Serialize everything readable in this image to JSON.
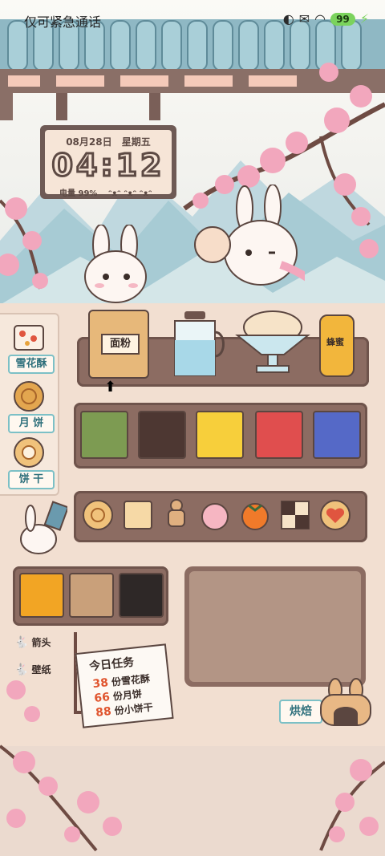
{
  "status_bar": {
    "carrier_text": "仅可紧急通话",
    "icons": [
      "notification-icon",
      "message-icon",
      "wifi-icon"
    ],
    "battery": "99"
  },
  "clock": {
    "date": "08月28日",
    "weekday": "星期五",
    "time": "04:12",
    "battery_label": "电量",
    "battery_value": "99%"
  },
  "counter_items": {
    "flour": "面粉",
    "honey": "蜂蜜"
  },
  "menu": {
    "items": [
      {
        "label": "雪花酥",
        "icon": "nougat-icon"
      },
      {
        "label": "月 饼",
        "icon": "mooncake-icon"
      },
      {
        "label": "饼 干",
        "icon": "cookie-icon"
      }
    ]
  },
  "toppings": [
    "matcha",
    "chocolate",
    "lemon",
    "strawberry",
    "blueberry"
  ],
  "cookies": [
    "swirl-cookie",
    "square-cookie",
    "gingerbread-man",
    "peach-bun",
    "persimmon",
    "checker-cookie",
    "heart-cookie"
  ],
  "mixins": [
    "mango",
    "nut-mix",
    "black-sesame"
  ],
  "options": [
    {
      "label": "箭头"
    },
    {
      "label": "壁纸"
    }
  ],
  "task": {
    "title": "今日任务",
    "lines": [
      {
        "count": "38",
        "text": "份雪花酥"
      },
      {
        "count": "66",
        "text": "份月饼"
      },
      {
        "count": "88",
        "text": "份小饼干"
      }
    ]
  },
  "bake_button": "烘焙",
  "colors": {
    "accent_teal": "#7cc0c6",
    "wood": "#8c6c62",
    "counter": "#f2dfd1",
    "task_count": "#e0552f",
    "blossom": "#f2a7bd"
  }
}
